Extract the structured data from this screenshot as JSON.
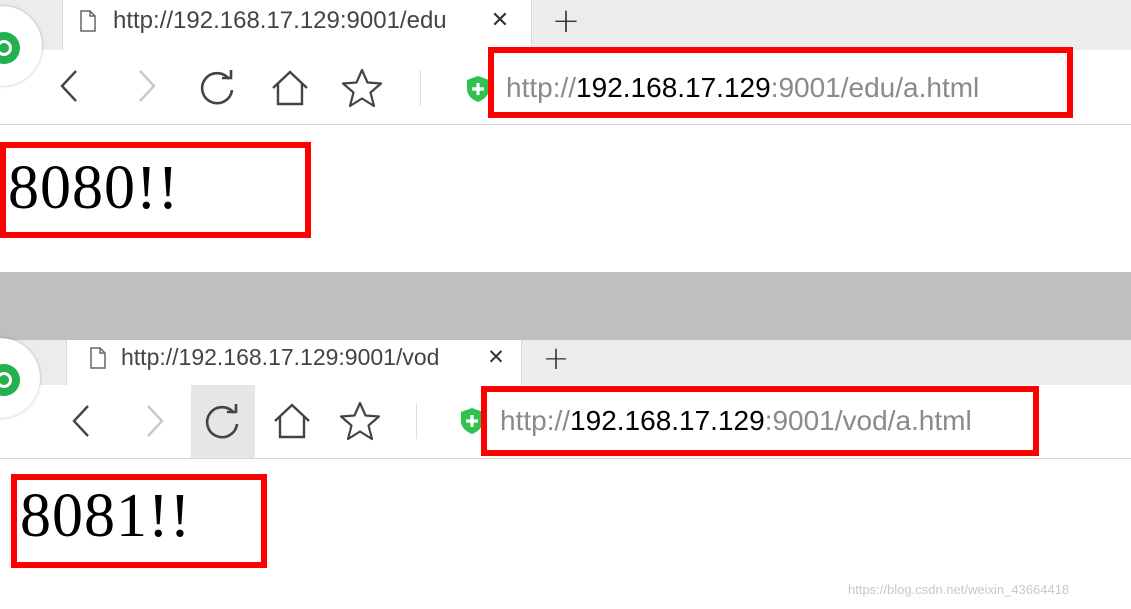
{
  "window1": {
    "tab_title": "http://192.168.17.129:9001/edu",
    "tab_close": "✕",
    "new_tab": "+",
    "url_scheme": "http://",
    "url_host": "192.168.17.129",
    "url_rest": ":9001/edu/a.html",
    "page_text": "8080!!"
  },
  "window2": {
    "tab_title": "http://192.168.17.129:9001/vod",
    "tab_close": "✕",
    "new_tab": "+",
    "url_scheme": "http://",
    "url_host": "192.168.17.129",
    "url_rest": ":9001/vod/a.html",
    "page_text": "8081!!"
  },
  "icons": [
    "browser-logo-icon",
    "page-icon",
    "back-icon",
    "forward-icon",
    "refresh-icon",
    "home-icon",
    "star-icon",
    "shield-icon"
  ],
  "colors": {
    "highlight": "#ff0000",
    "shield": "#2fc24e",
    "logo": "#23b14d",
    "divider": "#bfbfbf"
  },
  "watermark": "https://blog.csdn.net/weixin_43664418"
}
